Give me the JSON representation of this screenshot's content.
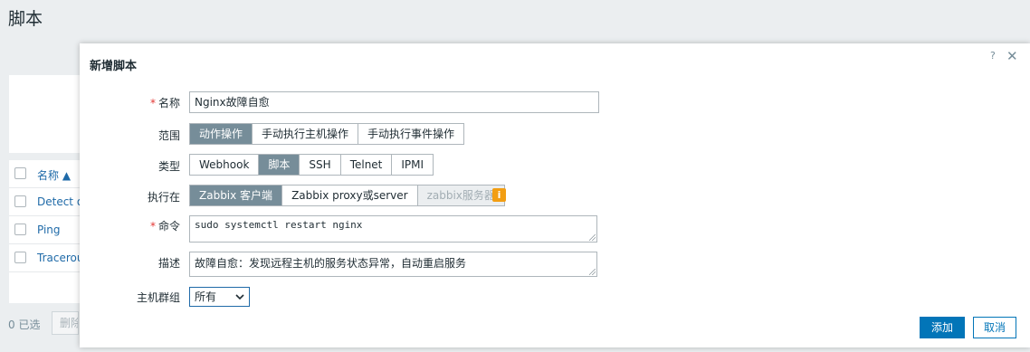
{
  "page": {
    "title": "脚本"
  },
  "background_table": {
    "header_name": "名称 ▲",
    "rows": [
      "Detect op",
      "Ping",
      "Tracerou"
    ],
    "selected_count": "0 已选",
    "delete_label": "删除"
  },
  "modal": {
    "title": "新增脚本",
    "help": "?",
    "close": "✕",
    "fields": {
      "name": {
        "label": "名称",
        "required": true,
        "value": "Nginx故障自愈"
      },
      "scope": {
        "label": "范围",
        "options": [
          "动作操作",
          "手动执行主机操作",
          "手动执行事件操作"
        ],
        "selected": "动作操作"
      },
      "type": {
        "label": "类型",
        "options": [
          "Webhook",
          "脚本",
          "SSH",
          "Telnet",
          "IPMI"
        ],
        "selected": "脚本"
      },
      "execute_on": {
        "label": "执行在",
        "options": [
          "Zabbix 客户端",
          "Zabbix proxy或server",
          "zabbix服务器"
        ],
        "selected": "Zabbix 客户端",
        "disabled": "zabbix服务器",
        "info_icon": "i"
      },
      "command": {
        "label": "命令",
        "required": true,
        "value": "sudo systemctl restart nginx"
      },
      "description": {
        "label": "描述",
        "value": "故障自愈：发现远程主机的服务状态异常，自动重启服务"
      },
      "host_group": {
        "label": "主机群组",
        "value": "所有"
      }
    },
    "buttons": {
      "add": "添加",
      "cancel": "取消"
    }
  },
  "colors": {
    "accent": "#0275b8",
    "selected_segment": "#768d99",
    "required": "#e33734",
    "info": "#f29e13"
  }
}
